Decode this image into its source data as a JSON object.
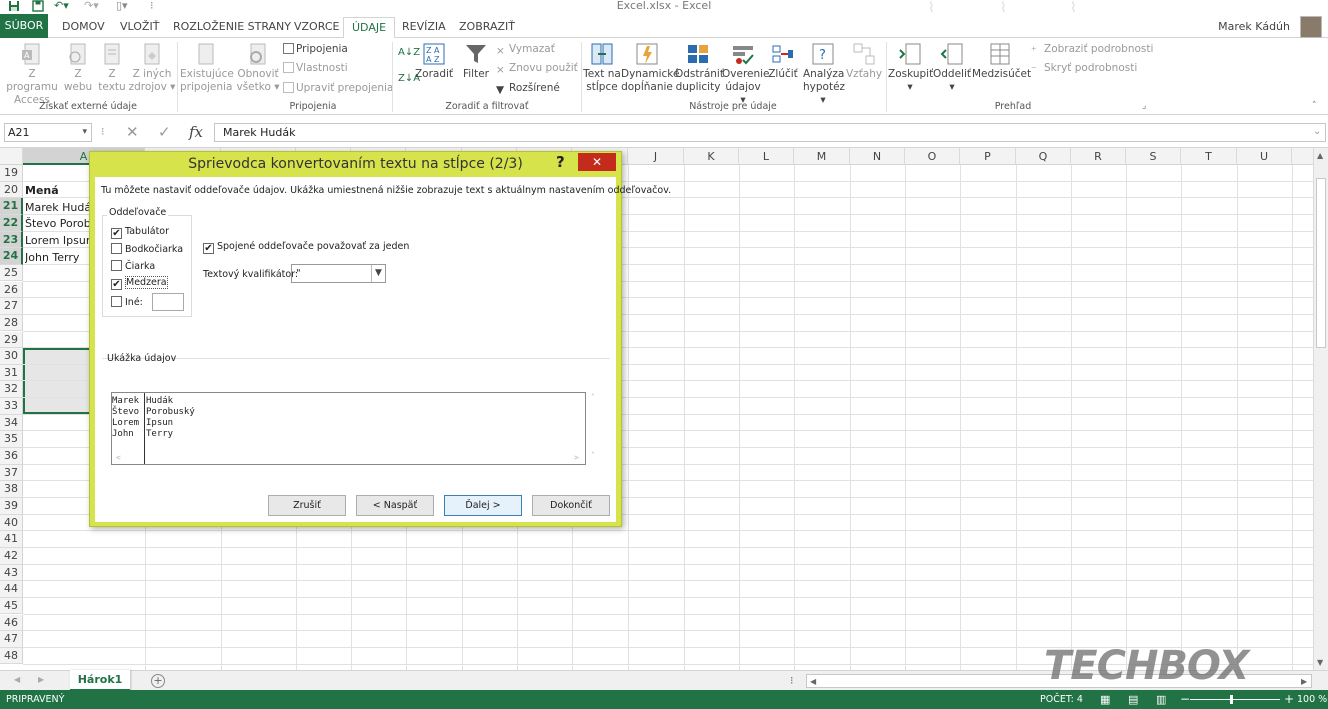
{
  "window": {
    "title": "Excel.xlsx - Excel",
    "user": "Marek Kádúh"
  },
  "tabs": [
    "SÚBOR",
    "DOMOV",
    "VLOŽIŤ",
    "ROZLOŽENIE STRANY",
    "VZORCE",
    "ÚDAJE",
    "REVÍZIA",
    "ZOBRAZIŤ"
  ],
  "ribbon": {
    "ext": {
      "access": [
        "Z programu",
        "Access"
      ],
      "web": [
        "Z",
        "webu"
      ],
      "text": [
        "Z",
        "textu"
      ],
      "other": [
        "Z iných",
        "zdrojov ▾"
      ],
      "group": "Získať externé údaje"
    },
    "conn": {
      "existing": [
        "Existujúce",
        "pripojenia"
      ],
      "refresh": [
        "Obnoviť",
        "všetko ▾"
      ],
      "connections": "Pripojenia",
      "properties": "Vlastnosti",
      "edit_links": "Upraviť prepojenia",
      "group": "Pripojenia"
    },
    "sort": {
      "sort": "Zoradiť",
      "filter": "Filter",
      "clear": "Vymazať",
      "reapply": "Znovu použiť",
      "advanced": "Rozšírené",
      "group": "Zoradiť a filtrovať"
    },
    "tools": {
      "t2c": [
        "Text na",
        "stĺpce"
      ],
      "flash": [
        "Dynamické",
        "dopĺňanie"
      ],
      "dup": [
        "Odstrániť",
        "duplicity"
      ],
      "valid": [
        "Overenie",
        "údajov ▾"
      ],
      "consol": "Zlúčiť",
      "whatif": [
        "Analýza",
        "hypotéz ▾"
      ],
      "rel": "Vzťahy",
      "group": "Nástroje pre údaje"
    },
    "outline": {
      "group_btn": "Zoskupiť",
      "ungroup": "Oddeliť",
      "subtotal": "Medzisúčet",
      "show": "Zobraziť podrobnosti",
      "hide": "Skryť podrobnosti",
      "group": "Prehľad"
    }
  },
  "formula_bar": {
    "name_box": "A21",
    "fx": "fx",
    "value": "Marek Hudák"
  },
  "grid": {
    "columns": [
      "A",
      "",
      "",
      "",
      "",
      "",
      "",
      "",
      "",
      "J",
      "K",
      "L",
      "M",
      "N",
      "O",
      "P",
      "Q",
      "R",
      "S",
      "T",
      "U"
    ],
    "rows": [
      "19",
      "20",
      "21",
      "22",
      "23",
      "24",
      "25",
      "26",
      "27",
      "28",
      "29",
      "30",
      "31",
      "32",
      "33",
      "34",
      "35",
      "36",
      "37",
      "38",
      "39",
      "40",
      "41",
      "42",
      "43",
      "44",
      "45",
      "46",
      "47",
      "48"
    ],
    "cells": {
      "r20": "Mená",
      "r21": "Marek Hudák",
      "r22": "Števo Porobuský",
      "r23": "Lorem Ipsun",
      "r24": "John Terry"
    }
  },
  "sheet": {
    "name": "Hárok1"
  },
  "status": {
    "ready": "PRIPRAVENÝ",
    "count": "POČET: 4",
    "zoom": "100 %"
  },
  "watermark": "TECHBOX",
  "dialog": {
    "title": "Sprievodca konvertovaním textu na stĺpce (2/3)",
    "help": "?",
    "close": "✕",
    "description": "Tu môžete nastaviť oddeľovače údajov. Ukážka umiestnená nižšie zobrazuje text s aktuálnym nastavením oddeľovačov.",
    "delim_label": "Oddeľovače",
    "delims": [
      {
        "label": "Tabulátor",
        "checked": "✔"
      },
      {
        "label": "Bodkočiarka",
        "checked": ""
      },
      {
        "label": "Čiarka",
        "checked": ""
      },
      {
        "label": "Medzera",
        "checked": "✔"
      },
      {
        "label": "Iné:",
        "checked": ""
      }
    ],
    "consecutive": {
      "label": "Spojené oddeľovače považovať za jeden",
      "checked": "✔"
    },
    "qualifier_label": "Textový kvalifikátor:",
    "qualifier_value": "\"",
    "preview_label": "Ukážka údajov",
    "preview_rows": [
      [
        "Marek",
        "Hudák"
      ],
      [
        "Števo",
        "Porobuský"
      ],
      [
        "Lorem",
        "Ipsun"
      ],
      [
        "John",
        "Terry"
      ]
    ],
    "buttons": {
      "cancel": "Zrušiť",
      "back": "< Naspäť",
      "next": "Ďalej >",
      "finish": "Dokončiť"
    }
  }
}
